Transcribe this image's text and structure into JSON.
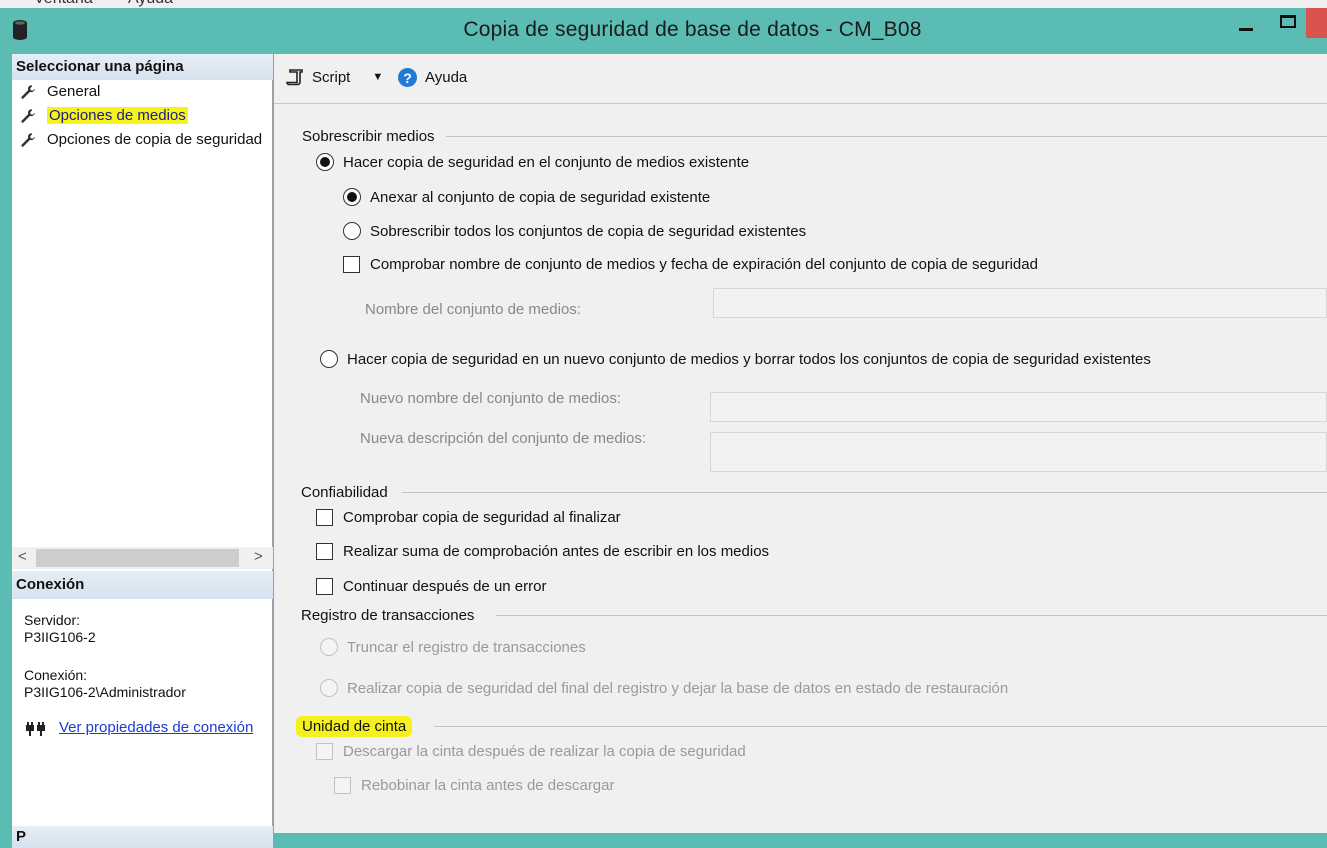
{
  "menubar": {
    "items": [
      "Ventana",
      "Ayuda"
    ]
  },
  "window": {
    "title": "Copia de seguridad de base de datos - CM_B08"
  },
  "left": {
    "select_page_header": "Seleccionar una página",
    "pages": [
      {
        "label": "General",
        "highlighted": false
      },
      {
        "label": "Opciones de medios",
        "highlighted": true
      },
      {
        "label": "Opciones de copia de seguridad",
        "highlighted": false
      }
    ],
    "connection_header": "Conexión",
    "server_label": "Servidor:",
    "server_value": "P3IIG106-2",
    "connection_label": "Conexión:",
    "connection_value": "P3IIG106-2\\Administrador",
    "view_connection_link": "Ver propiedades de conexión",
    "progress_header": "P"
  },
  "toolbar": {
    "script_label": "Script",
    "help_label": "Ayuda"
  },
  "overwrite": {
    "group_label": "Sobrescribir medios",
    "backup_existing": {
      "label": "Hacer copia de seguridad en el conjunto de medios existente",
      "selected": true
    },
    "append": {
      "label": "Anexar al conjunto de copia de seguridad existente",
      "selected": true
    },
    "overwrite_all": {
      "label": "Sobrescribir todos los conjuntos de copia de seguridad existentes",
      "selected": false
    },
    "check_media": {
      "label": "Comprobar nombre de conjunto de medios y fecha de expiración del conjunto de copia de seguridad",
      "checked": false
    },
    "media_name_label": "Nombre del conjunto de medios:",
    "media_name_value": "",
    "backup_new": {
      "label": "Hacer copia de seguridad en un nuevo conjunto de medios y borrar todos los conjuntos de copia de seguridad existentes",
      "selected": false
    },
    "new_media_name_label": "Nuevo nombre del conjunto de medios:",
    "new_media_name_value": "",
    "new_media_desc_label": "Nueva descripción del conjunto de medios:",
    "new_media_desc_value": ""
  },
  "reliability": {
    "group_label": "Confiabilidad",
    "verify": {
      "label": "Comprobar copia de seguridad al finalizar",
      "checked": false
    },
    "checksum": {
      "label": "Realizar suma de comprobación antes de escribir en los medios",
      "checked": false
    },
    "continue_on_error": {
      "label": "Continuar después de un error",
      "checked": false
    }
  },
  "transaction_log": {
    "group_label": "Registro de transacciones",
    "truncate": {
      "label": "Truncar el registro de transacciones",
      "selected": false
    },
    "tail_log": {
      "label": "Realizar copia de seguridad del final del registro y dejar la base de datos en estado de restauración",
      "selected": false
    }
  },
  "tape": {
    "group_label": "Unidad de cinta",
    "unload": {
      "label": "Descargar la cinta después de realizar la copia de seguridad",
      "checked": false
    },
    "rewind": {
      "label": "Rebobinar la cinta antes de descargar",
      "checked": false
    }
  },
  "colors": {
    "titlebar": "#5bbcb4",
    "highlight": "#f5f21c",
    "link": "#1a3bd6"
  }
}
